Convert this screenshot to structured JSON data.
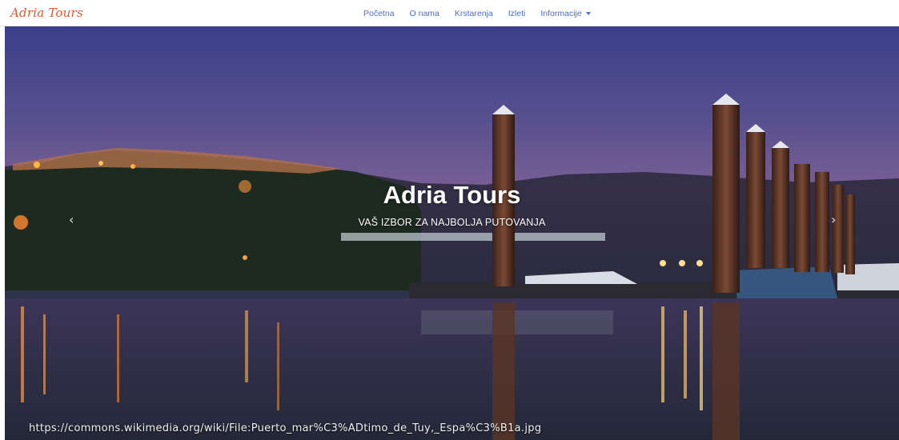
{
  "brand": "Adria Tours",
  "nav": {
    "items": [
      "Početna",
      "O nama",
      "Krstarenja",
      "Izleti"
    ],
    "dropdown_label": "Informacije"
  },
  "carousel": {
    "title": "Adria Tours",
    "subtitle": "VAŠ IZBOR ZA NAJBOLJA PUTOVANJA",
    "image_credit": "https://commons.wikimedia.org/wiki/File:Puerto_mar%C3%ADtimo_de_Tuy,_Espa%C3%B1a.jpg",
    "prev_icon": "chevron-left-icon",
    "next_icon": "chevron-right-icon"
  },
  "colors": {
    "brand": "#e8562a",
    "nav_link": "#4a6bd6",
    "sky": "#57508e",
    "water": "#2b2f45"
  }
}
